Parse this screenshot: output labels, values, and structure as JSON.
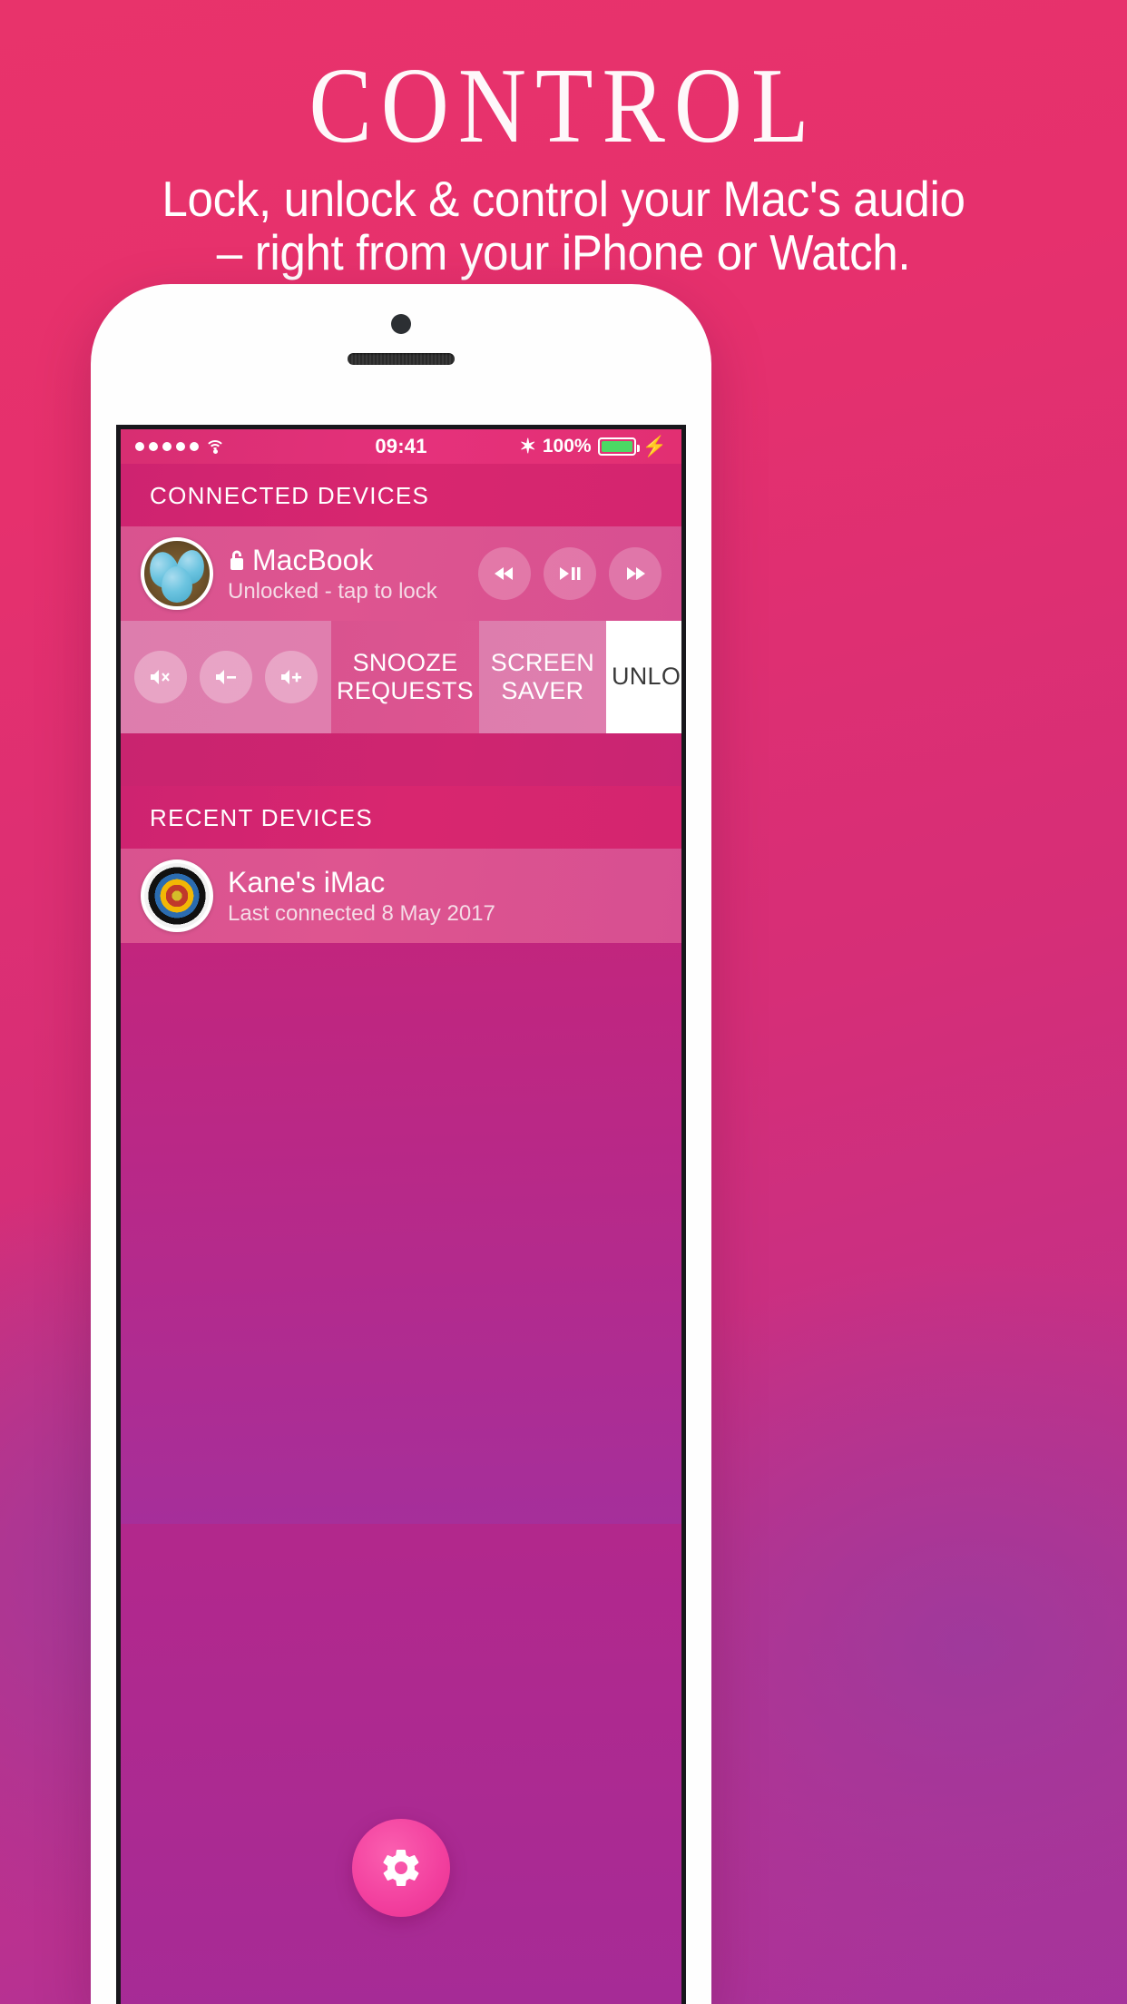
{
  "promo": {
    "title": "CONTROL",
    "subtitle_line1": "Lock, unlock & control your Mac's audio",
    "subtitle_line2": "– right from your iPhone or Watch."
  },
  "statusbar": {
    "signal_dots": 5,
    "wifi_icon": "wifi-icon",
    "time": "09:41",
    "bluetooth_icon": "✶",
    "battery_percent": "100%",
    "battery_color": "#4cd964",
    "charging_icon": "⚡"
  },
  "sections": {
    "connected_header": "CONNECTED DEVICES",
    "recent_header": "RECENT DEVICES"
  },
  "connected_device": {
    "avatar": "eggs-in-nest-avatar",
    "lock_icon": "🔒",
    "name": "MacBook",
    "status": "Unlocked - tap to lock",
    "media": {
      "rewind": "◀◀",
      "play_pause": "▶❙❙",
      "fast_forward": "▶▶"
    }
  },
  "action_row": {
    "volume": {
      "mute_label": "◀×",
      "down_label": "◀−",
      "up_label": "◀+"
    },
    "snooze_line1": "SNOOZE",
    "snooze_line2": "REQUESTS",
    "screensaver_line1": "SCREEN",
    "screensaver_line2": "SAVER",
    "unlock_label": "UNLOCK"
  },
  "recent_device": {
    "avatar": "target-dartboard-avatar",
    "name": "Kane's iMac",
    "status": "Last connected 8 May 2017"
  },
  "fab": {
    "icon": "gear-icon",
    "color": "#f23f9e"
  },
  "colors": {
    "background_start": "#e8336b",
    "background_end": "#a5339c",
    "accent_header": "#d4256f",
    "row_pink": "#d9538f",
    "unlock_white": "#ffffff"
  }
}
